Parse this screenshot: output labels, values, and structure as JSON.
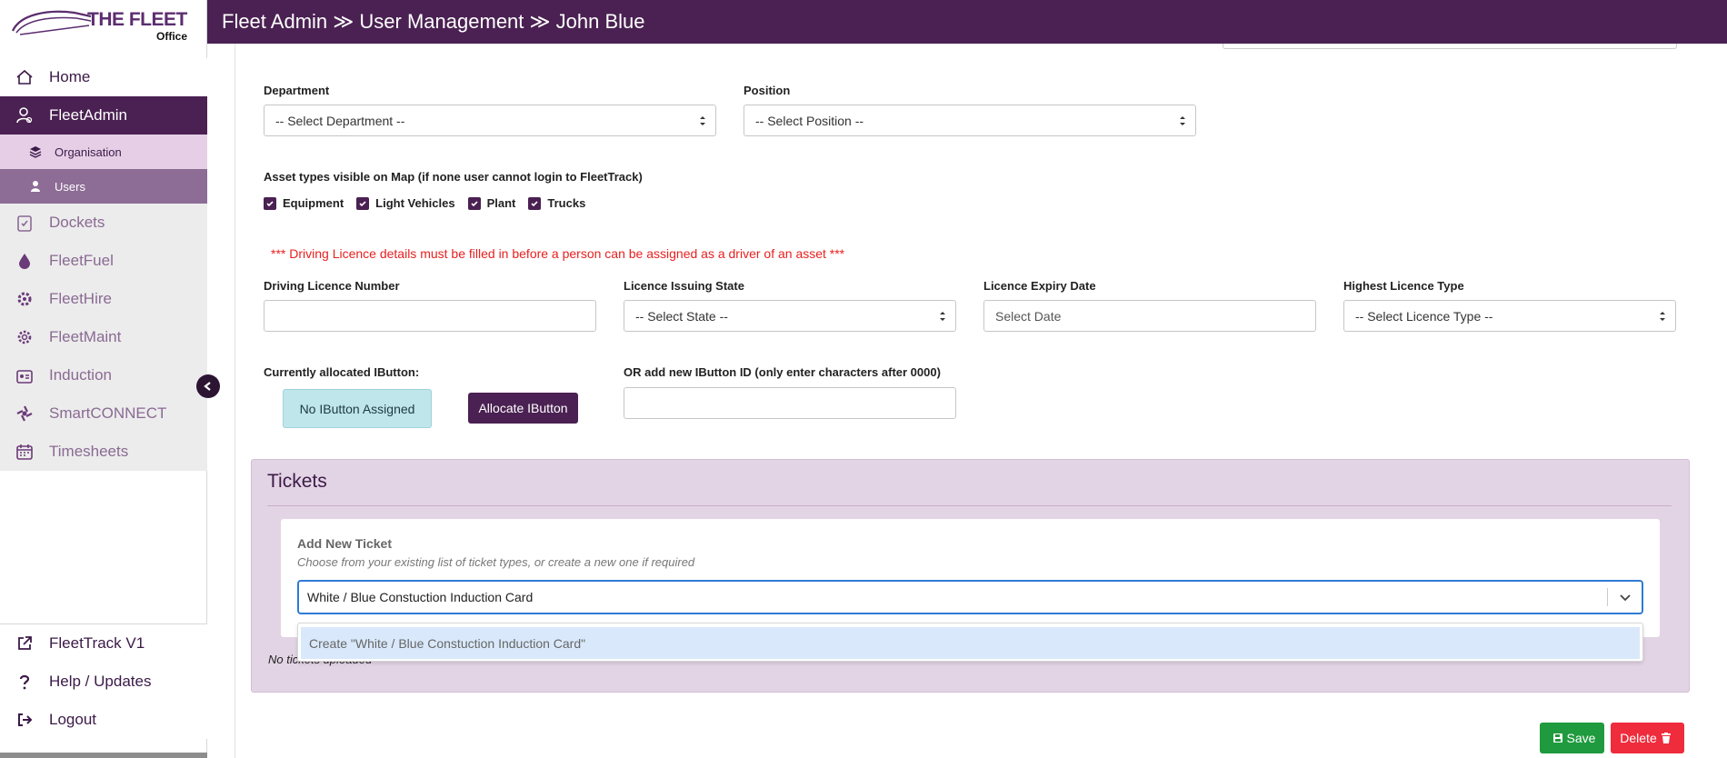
{
  "brand": {
    "name": "THE FLEET",
    "sub": "Office"
  },
  "header": {
    "breadcrumb": "Fleet Admin ≫ User Management ≫ John Blue"
  },
  "sidebar": {
    "items": [
      {
        "label": "Home",
        "icon": "home-icon"
      },
      {
        "label": "FleetAdmin",
        "icon": "user-admin-icon"
      },
      {
        "label": "Organisation",
        "icon": "layers-icon"
      },
      {
        "label": "Users",
        "icon": "user-icon"
      },
      {
        "label": "Dockets",
        "icon": "clipboard-icon"
      },
      {
        "label": "FleetFuel",
        "icon": "drop-icon"
      },
      {
        "label": "FleetHire",
        "icon": "hire-gear-icon"
      },
      {
        "label": "FleetMaint",
        "icon": "maint-gear-icon"
      },
      {
        "label": "Induction",
        "icon": "induction-icon"
      },
      {
        "label": "SmartCONNECT",
        "icon": "connect-icon"
      },
      {
        "label": "Timesheets",
        "icon": "calendar-icon"
      }
    ],
    "bottom": [
      {
        "label": "FleetTrack V1",
        "icon": "external-link-icon"
      },
      {
        "label": "Help / Updates",
        "icon": "question-icon"
      },
      {
        "label": "Logout",
        "icon": "logout-icon"
      }
    ]
  },
  "form": {
    "department_label": "Department",
    "department_value": "-- Select Department --",
    "position_label": "Position",
    "position_value": "-- Select Position --",
    "asset_types_label": "Asset types visible on Map (if none user cannot login to FleetTrack)",
    "asset_types": [
      "Equipment",
      "Light Vehicles",
      "Plant",
      "Trucks"
    ],
    "licence_warning": "*** Driving Licence details must be filled in before a person can be assigned as a driver of an asset ***",
    "licence_number_label": "Driving Licence Number",
    "licence_state_label": "Licence Issuing State",
    "licence_state_value": "-- Select State --",
    "licence_expiry_label": "Licence Expiry Date",
    "licence_expiry_placeholder": "Select Date",
    "licence_type_label": "Highest Licence Type",
    "licence_type_value": "-- Select Licence Type --",
    "ibutton_label": "Currently allocated IButton:",
    "ibutton_status": "No IButton Assigned",
    "allocate_label": "Allocate IButton",
    "new_ibutton_label": "OR add new IButton ID (only enter characters after 0000)"
  },
  "tickets": {
    "title": "Tickets",
    "card_title": "Add New Ticket",
    "card_sub": "Choose from your existing list of ticket types, or create a new one if required",
    "combo_value": "White / Blue Constuction Induction Card",
    "dropdown_option": "Create \"White / Blue Constuction Induction Card\"",
    "no_tickets": "No tickets uploaded"
  },
  "actions": {
    "save": "Save",
    "delete": "Delete"
  },
  "colors": {
    "brand_purple": "#4a2152",
    "save_green": "#1f9a3e",
    "delete_red": "#ee2c3c",
    "warning_red": "#e82020"
  }
}
